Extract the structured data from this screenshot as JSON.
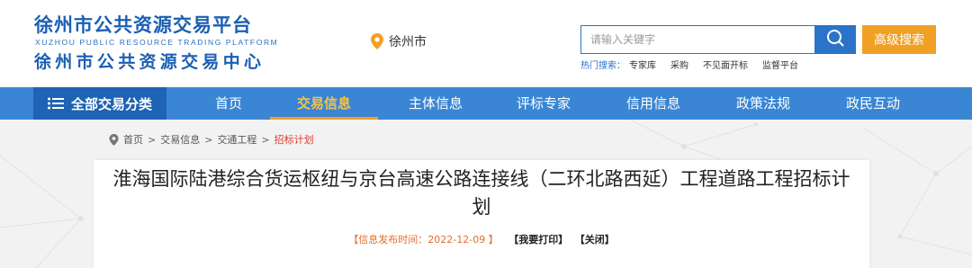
{
  "header": {
    "logo_cn_top": "徐州市公共资源交易平台",
    "logo_en": "XUZHOU PUBLIC RESOURCE TRADING PLATFORM",
    "logo_cn_bottom": "徐州市公共资源交易中心",
    "location": "徐州市",
    "search": {
      "placeholder": "请输入关键字",
      "value": ""
    },
    "advanced_search_label": "高级搜索",
    "hot_search": {
      "label": "热门搜索：",
      "items": [
        "专家库",
        "采购",
        "不见面开标",
        "监督平台"
      ]
    }
  },
  "nav": {
    "all_categories": "全部交易分类",
    "items": [
      {
        "label": "首页",
        "active": false
      },
      {
        "label": "交易信息",
        "active": true
      },
      {
        "label": "主体信息",
        "active": false
      },
      {
        "label": "评标专家",
        "active": false
      },
      {
        "label": "信用信息",
        "active": false
      },
      {
        "label": "政策法规",
        "active": false
      },
      {
        "label": "政民互动",
        "active": false
      }
    ]
  },
  "breadcrumb": {
    "items": [
      "首页",
      "交易信息",
      "交通工程"
    ],
    "separator": ">",
    "current": "招标计划"
  },
  "article": {
    "title": "淮海国际陆港综合货运枢纽与京台高速公路连接线（二环北路西延）工程道路工程招标计划",
    "meta": {
      "date_text": "【信息发布时间：2022-12-09 】",
      "print_label": "【我要打印】",
      "close_label": "【关闭】"
    }
  },
  "colors": {
    "brand_blue": "#1a5fb4",
    "nav_blue": "#3a86d4",
    "nav_dark": "#1e63b4",
    "accent_orange": "#f2a024",
    "breadcrumb_current": "#e03b2c"
  }
}
